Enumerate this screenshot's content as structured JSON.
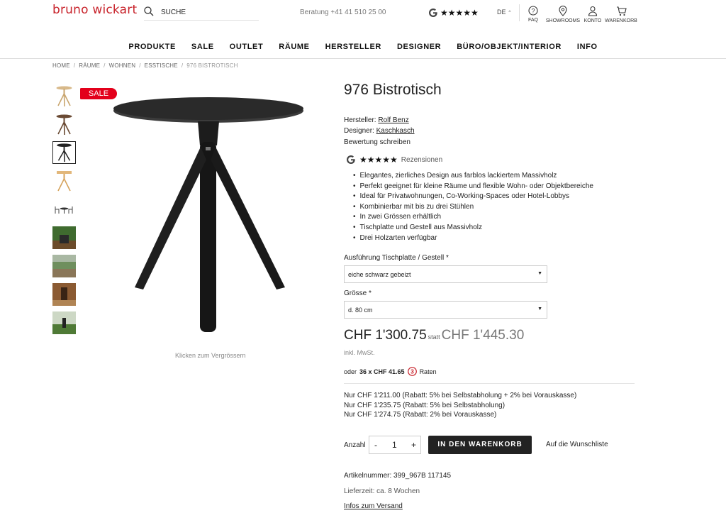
{
  "header": {
    "logo": "bruno wickart",
    "search_label": "SUCHE",
    "hotline": "Beratung +41 41 510 25 00",
    "rating_stars": "★★★★★",
    "language": "DE",
    "utils": [
      {
        "label": "FAQ",
        "icon": "help-circle-icon"
      },
      {
        "label": "SHOWROOMS",
        "icon": "map-pin-icon"
      },
      {
        "label": "KONTO",
        "icon": "user-icon"
      },
      {
        "label": "WARENKORB",
        "icon": "cart-icon"
      }
    ]
  },
  "nav": [
    "PRODUKTE",
    "SALE",
    "OUTLET",
    "RÄUME",
    "HERSTELLER",
    "DESIGNER",
    "BÜRO/OBJEKT/INTERIOR",
    "INFO"
  ],
  "breadcrumb": [
    "HOME",
    "RÄUME",
    "WOHNEN",
    "ESSTISCHE",
    "976 BISTROTISCH"
  ],
  "gallery": {
    "sale_badge": "SALE",
    "zoom_hint": "Klicken zum Vergrössern",
    "thumbnail_count": 9,
    "selected_thumbnail": 3
  },
  "product": {
    "title": "976 Bistrotisch",
    "manufacturer_label": "Hersteller:",
    "manufacturer": "Rolf Benz",
    "designer_label": "Designer:",
    "designer": "Kaschkasch",
    "write_review": "Bewertung schreiben",
    "review_stars": "★★★★★",
    "reviews_label": "Rezensionen",
    "features": [
      "Elegantes, zierliches Design aus farblos lackiertem Massivholz",
      "Perfekt geeignet für kleine Räume und flexible Wohn- oder Objektbereiche",
      "Ideal für Privatwohnungen, Co-Working-Spaces oder Hotel-Lobbys",
      "Kombinierbar mit bis zu drei Stühlen",
      "In zwei Grössen erhältlich",
      "Tischplatte und Gestell aus Massivholz",
      "Drei Holzarten verfügbar"
    ],
    "option1_label": "Ausführung Tischplatte / Gestell",
    "option1_value": "eiche schwarz gebeizt",
    "option2_label": "Grösse",
    "option2_value": "d. 80 cm",
    "required_mark": "*",
    "price": "CHF 1'300.75",
    "statt": "statt",
    "old_price": "CHF 1'445.30",
    "vat": "inkl. MwSt.",
    "rate_prefix": "oder",
    "rate_value": "36 x CHF 41.65",
    "rate_suffix": "Raten",
    "discounts": [
      "Nur CHF 1'211.00 (Rabatt: 5% bei Selbstabholung + 2% bei Vorauskasse)",
      "Nur CHF 1'235.75 (Rabatt: 5% bei Selbstabholung)",
      "Nur CHF 1'274.75 (Rabatt: 2% bei Vorauskasse)"
    ],
    "qty_label": "Anzahl",
    "qty_minus": "-",
    "qty_value": "1",
    "qty_plus": "+",
    "cart_button": "IN DEN WARENKORB",
    "wishlist": "Auf die Wunschliste",
    "article_number": "Artikelnummer: 399_967B 117145",
    "delivery": "Lieferzeit: ca. 8 Wochen",
    "shipping_info": "Infos zum Versand"
  },
  "colors": {
    "brand_red": "#c8232b",
    "sale_red": "#e3001b",
    "dark": "#222222"
  }
}
